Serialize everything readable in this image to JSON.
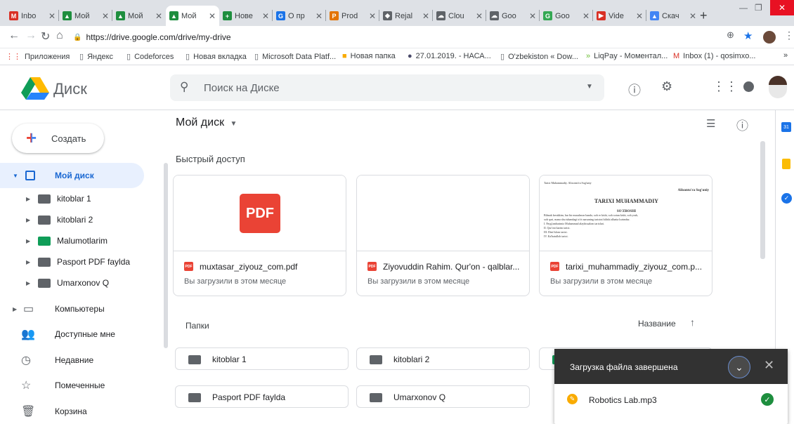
{
  "browser": {
    "tabs": [
      {
        "label": "Inbo",
        "color": "#d93025",
        "glyph": "M"
      },
      {
        "label": "Мой",
        "color": "#1e8e3e",
        "glyph": "▲"
      },
      {
        "label": "Мой",
        "color": "#1e8e3e",
        "glyph": "▲"
      },
      {
        "label": "Мой",
        "color": "#1e8e3e",
        "glyph": "▲"
      },
      {
        "label": "Нове",
        "color": "#1e8e3e",
        "glyph": "+"
      },
      {
        "label": "О пр",
        "color": "#1a73e8",
        "glyph": "G"
      },
      {
        "label": "Prod",
        "color": "#e37400",
        "glyph": "P"
      },
      {
        "label": "Rejal",
        "color": "#5f6368",
        "glyph": "◆"
      },
      {
        "label": "Clou",
        "color": "#5f6368",
        "glyph": "☁"
      },
      {
        "label": "Goo",
        "color": "#5f6368",
        "glyph": "☁"
      },
      {
        "label": "Goo",
        "color": "#34a853",
        "glyph": "G"
      },
      {
        "label": "Vide",
        "color": "#d93025",
        "glyph": "▶"
      },
      {
        "label": "Скач",
        "color": "#4285f4",
        "glyph": "▲"
      }
    ],
    "new_tab_glyph": "+",
    "url": "https://drive.google.com/drive/my-drive",
    "bookmarks": [
      {
        "label": "Приложения",
        "icon": "apps-icon"
      },
      {
        "label": "Яндекс",
        "icon": "page-icon"
      },
      {
        "label": "Codeforces",
        "icon": "page-icon"
      },
      {
        "label": "Новая вкладка",
        "icon": "page-icon"
      },
      {
        "label": "Microsoft Data Platf...",
        "icon": "page-icon"
      },
      {
        "label": "Новая папка",
        "icon": "folder-icon"
      },
      {
        "label": "27.01.2019. - НАСА...",
        "icon": "nasa-icon"
      },
      {
        "label": "O'zbekiston « Dow...",
        "icon": "page-icon"
      },
      {
        "label": "LiqPay - Моментал...",
        "icon": "liqpay-icon"
      },
      {
        "label": "Inbox (1) - qosimxo...",
        "icon": "gmail-icon"
      }
    ],
    "bookmarks_more": "»"
  },
  "header": {
    "app_name": "Диск",
    "search_placeholder": "Поиск на Диске"
  },
  "sidebar": {
    "create_label": "Создать",
    "my_drive": "Мой диск",
    "folders": [
      {
        "label": "kitoblar 1",
        "color": "#5f6368"
      },
      {
        "label": "kitoblari 2",
        "color": "#5f6368"
      },
      {
        "label": "Malumotlarim",
        "color": "#0f9d58"
      },
      {
        "label": "Pasport PDF faylda",
        "color": "#5f6368"
      },
      {
        "label": "Umarxonov Q",
        "color": "#5f6368"
      }
    ],
    "computers": "Компьютеры",
    "shared": "Доступные мне",
    "recent": "Недавние",
    "starred": "Помеченные",
    "trash": "Корзина"
  },
  "main": {
    "title": "Мой диск",
    "quick_access_label": "Быстрый доступ",
    "quick_access": [
      {
        "name": "muxtasar_ziyouz_com.pdf",
        "sub": "Вы загрузили в этом месяце",
        "thumb_type": "pdf",
        "thumb_text": "PDF"
      },
      {
        "name": "Ziyovuddin Rahim. Qur'on - qalblar...",
        "sub": "Вы загрузили в этом месяце",
        "thumb_type": "blank"
      },
      {
        "name": "tarixi_muhammadiy_ziyouz_com.p...",
        "sub": "Вы загрузили в этом месяце",
        "thumb_type": "doc"
      }
    ],
    "doc_preview": {
      "top_left": "Tarixi Muhammadiy. Alixonto'ra Sog'uniy",
      "author": "Alixonto'ra Sog'uniy",
      "title": "TARIXI MUHAMMADIY",
      "section": "SO'ZBOSHI",
      "lines": [
        "Bilmak kerakkim, har bir musulmon banda, xoh er kishi, xoh xotun kishi, xoh yosh,",
        "xoh qari, mana shu tubandagi to'rt narsaning tarixini bilishi albatta lozimdur.",
        "I. Payg'ambarimiz Muhammad alayhissalom tarixlari.",
        "II. Qur'oni karim tarixi.",
        "III. Dini Islom tarixi.",
        "IV. Ka'batulloh tarixi."
      ]
    },
    "folders_label": "Папки",
    "sort_label": "Название",
    "folders": [
      {
        "label": "kitoblar 1"
      },
      {
        "label": "kitoblari 2"
      },
      {
        "label": "Pasport PDF faylda"
      },
      {
        "label": "Umarxonov Q"
      }
    ]
  },
  "toast": {
    "title": "Загрузка файла завершена",
    "file": "Robotics Lab.mp3"
  },
  "rail": {
    "calendar_day": "31"
  }
}
